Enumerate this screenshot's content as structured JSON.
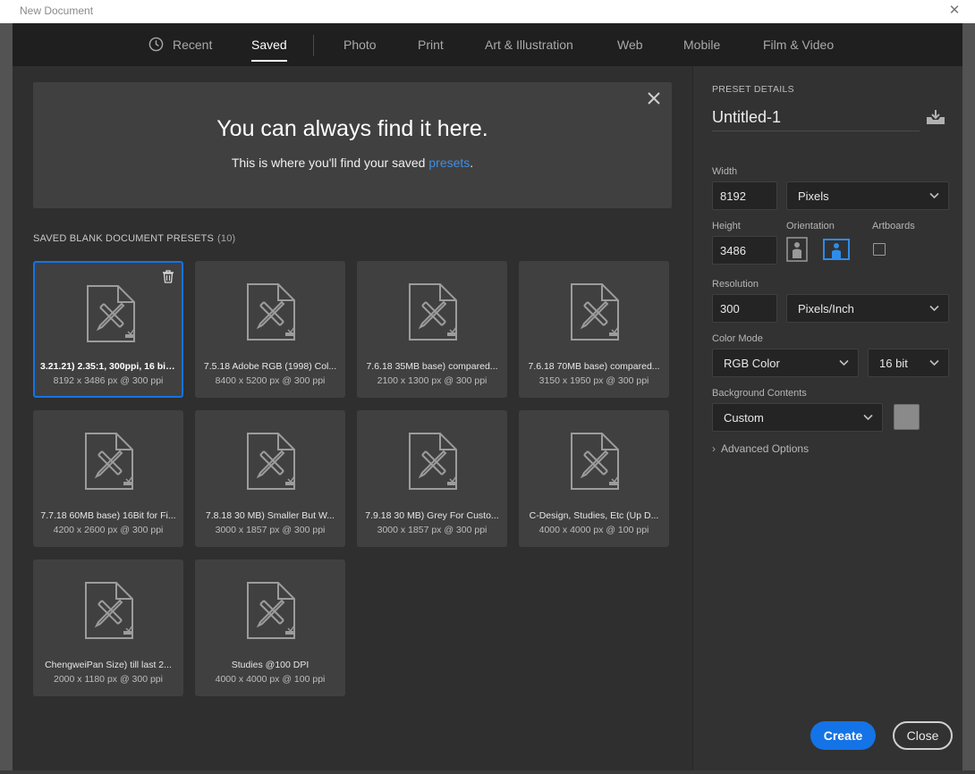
{
  "window": {
    "title": "New Document"
  },
  "tabs": [
    {
      "label": "Recent"
    },
    {
      "label": "Saved"
    },
    {
      "label": "Photo"
    },
    {
      "label": "Print"
    },
    {
      "label": "Art & Illustration"
    },
    {
      "label": "Web"
    },
    {
      "label": "Mobile"
    },
    {
      "label": "Film & Video"
    }
  ],
  "active_tab": "Saved",
  "banner": {
    "title": "You can always find it here.",
    "subtitle_prefix": "This is where you'll find your saved ",
    "subtitle_link": "presets",
    "subtitle_suffix": "."
  },
  "presets_section": {
    "label": "SAVED BLANK DOCUMENT PRESETS",
    "count": "(10)"
  },
  "presets": [
    {
      "name": "3.21.21) 2.35:1, 300ppi, 16 bit, ...",
      "dims": "8192 x 3486 px @ 300 ppi"
    },
    {
      "name": "7.5.18 Adobe RGB (1998) Col...",
      "dims": "8400 x 5200 px @ 300 ppi"
    },
    {
      "name": "7.6.18 35MB base) compared...",
      "dims": "2100 x 1300 px @ 300 ppi"
    },
    {
      "name": "7.6.18 70MB base) compared...",
      "dims": "3150 x 1950 px @ 300 ppi"
    },
    {
      "name": "7.7.18 60MB base) 16Bit for Fi...",
      "dims": "4200 x 2600 px @ 300 ppi"
    },
    {
      "name": "7.8.18 30 MB) Smaller But W...",
      "dims": "3000 x 1857 px @ 300 ppi"
    },
    {
      "name": "7.9.18 30 MB) Grey For Custo...",
      "dims": "3000 x 1857 px @ 300 ppi"
    },
    {
      "name": "C-Design, Studies, Etc (Up D...",
      "dims": "4000 x 4000 px @ 100 ppi"
    },
    {
      "name": "ChengweiPan Size) till last 2...",
      "dims": "2000 x 1180 px @ 300 ppi"
    },
    {
      "name": "Studies @100 DPI",
      "dims": "4000 x 4000 px @ 100 ppi"
    }
  ],
  "details": {
    "header": "PRESET DETAILS",
    "doc_name": "Untitled-1",
    "width_label": "Width",
    "width_value": "8192",
    "width_unit": "Pixels",
    "height_label": "Height",
    "height_value": "3486",
    "orientation_label": "Orientation",
    "artboards_label": "Artboards",
    "resolution_label": "Resolution",
    "resolution_value": "300",
    "resolution_unit": "Pixels/Inch",
    "color_mode_label": "Color Mode",
    "color_mode": "RGB Color",
    "bit_depth": "16 bit",
    "bg_label": "Background Contents",
    "bg_value": "Custom",
    "bg_swatch": "#8a8a8a",
    "advanced": "Advanced Options"
  },
  "buttons": {
    "create": "Create",
    "close": "Close"
  },
  "colors": {
    "accent": "#1473e6",
    "link": "#3d8ee6"
  }
}
